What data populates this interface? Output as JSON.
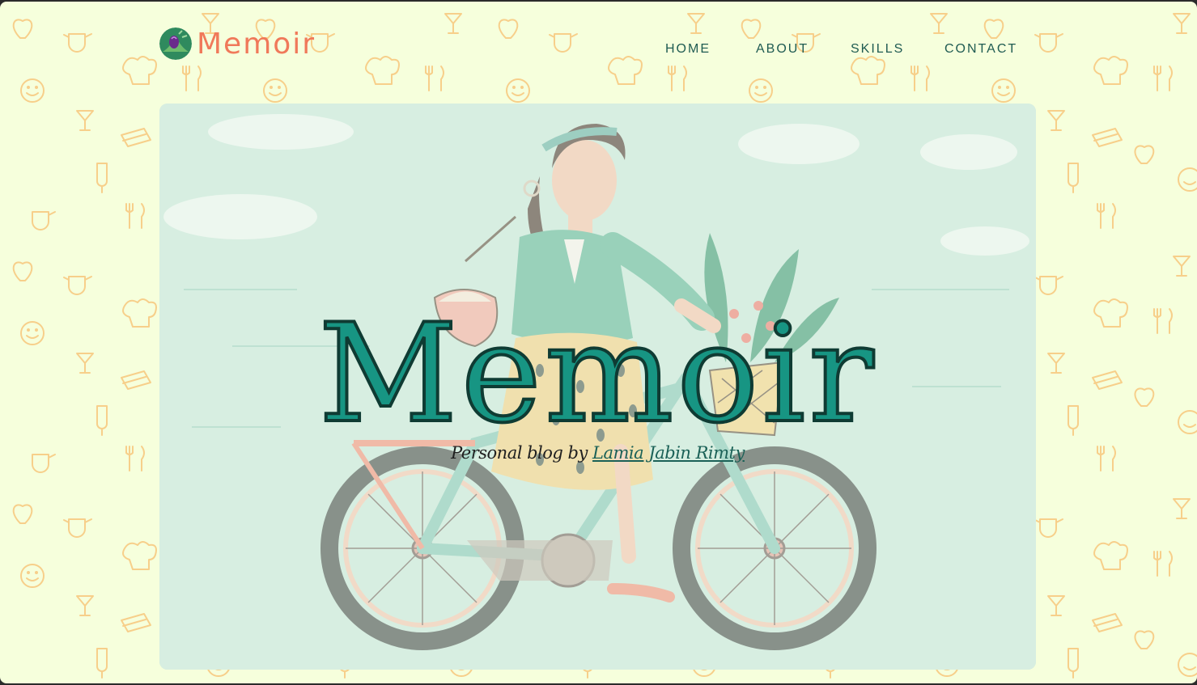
{
  "site": {
    "brand": "Memoir",
    "logo_icon": "tulip-icon"
  },
  "nav": {
    "items": [
      {
        "label": "HOME"
      },
      {
        "label": "ABOUT"
      },
      {
        "label": "SKILLS"
      },
      {
        "label": "CONTACT"
      }
    ]
  },
  "hero": {
    "title": "Memoir",
    "subtitle_prefix": "Personal blog by ",
    "author_link": "Lamia Jabin Rimty",
    "illustration": "woman-riding-bicycle-illustration"
  },
  "colors": {
    "page_bg": "#f6ffdc",
    "brand": "#f0795a",
    "nav_text": "#1f5b52",
    "title_fill": "#179583",
    "pattern": "#f7cf8a"
  }
}
